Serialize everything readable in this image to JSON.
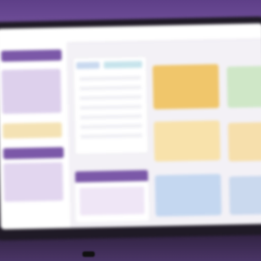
{
  "scene": {
    "description_hint": "",
    "colors": {
      "wall": "#6b4a92",
      "accent_purple": "#7b58a8",
      "card_orange": "#f0c66b",
      "card_green": "#cfe7c7",
      "card_yellow": "#f8e2ab",
      "card_blue": "#c4d7f0"
    }
  },
  "app": {
    "sidebar": {
      "sections": [
        {
          "name": "header"
        },
        {
          "name": "list"
        },
        {
          "name": "highlight"
        },
        {
          "name": "header-2"
        },
        {
          "name": "list-2"
        }
      ]
    },
    "cards": [
      {
        "color": "orange"
      },
      {
        "color": "green"
      },
      {
        "color": "yellow"
      },
      {
        "color": "yellow"
      },
      {
        "color": "blue"
      },
      {
        "color": "blue"
      }
    ]
  }
}
